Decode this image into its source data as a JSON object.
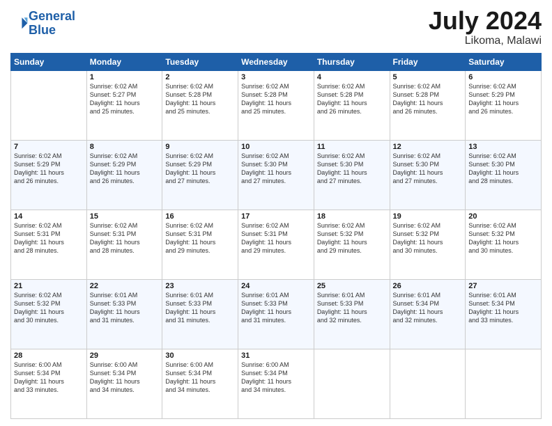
{
  "header": {
    "logo_line1": "General",
    "logo_line2": "Blue",
    "month_year": "July 2024",
    "location": "Likoma, Malawi"
  },
  "days_of_week": [
    "Sunday",
    "Monday",
    "Tuesday",
    "Wednesday",
    "Thursday",
    "Friday",
    "Saturday"
  ],
  "weeks": [
    [
      {
        "day": "",
        "info": ""
      },
      {
        "day": "1",
        "info": "Sunrise: 6:02 AM\nSunset: 5:27 PM\nDaylight: 11 hours\nand 25 minutes."
      },
      {
        "day": "2",
        "info": "Sunrise: 6:02 AM\nSunset: 5:28 PM\nDaylight: 11 hours\nand 25 minutes."
      },
      {
        "day": "3",
        "info": "Sunrise: 6:02 AM\nSunset: 5:28 PM\nDaylight: 11 hours\nand 25 minutes."
      },
      {
        "day": "4",
        "info": "Sunrise: 6:02 AM\nSunset: 5:28 PM\nDaylight: 11 hours\nand 26 minutes."
      },
      {
        "day": "5",
        "info": "Sunrise: 6:02 AM\nSunset: 5:28 PM\nDaylight: 11 hours\nand 26 minutes."
      },
      {
        "day": "6",
        "info": "Sunrise: 6:02 AM\nSunset: 5:29 PM\nDaylight: 11 hours\nand 26 minutes."
      }
    ],
    [
      {
        "day": "7",
        "info": "Sunrise: 6:02 AM\nSunset: 5:29 PM\nDaylight: 11 hours\nand 26 minutes."
      },
      {
        "day": "8",
        "info": "Sunrise: 6:02 AM\nSunset: 5:29 PM\nDaylight: 11 hours\nand 26 minutes."
      },
      {
        "day": "9",
        "info": "Sunrise: 6:02 AM\nSunset: 5:29 PM\nDaylight: 11 hours\nand 27 minutes."
      },
      {
        "day": "10",
        "info": "Sunrise: 6:02 AM\nSunset: 5:30 PM\nDaylight: 11 hours\nand 27 minutes."
      },
      {
        "day": "11",
        "info": "Sunrise: 6:02 AM\nSunset: 5:30 PM\nDaylight: 11 hours\nand 27 minutes."
      },
      {
        "day": "12",
        "info": "Sunrise: 6:02 AM\nSunset: 5:30 PM\nDaylight: 11 hours\nand 27 minutes."
      },
      {
        "day": "13",
        "info": "Sunrise: 6:02 AM\nSunset: 5:30 PM\nDaylight: 11 hours\nand 28 minutes."
      }
    ],
    [
      {
        "day": "14",
        "info": "Sunrise: 6:02 AM\nSunset: 5:31 PM\nDaylight: 11 hours\nand 28 minutes."
      },
      {
        "day": "15",
        "info": "Sunrise: 6:02 AM\nSunset: 5:31 PM\nDaylight: 11 hours\nand 28 minutes."
      },
      {
        "day": "16",
        "info": "Sunrise: 6:02 AM\nSunset: 5:31 PM\nDaylight: 11 hours\nand 29 minutes."
      },
      {
        "day": "17",
        "info": "Sunrise: 6:02 AM\nSunset: 5:31 PM\nDaylight: 11 hours\nand 29 minutes."
      },
      {
        "day": "18",
        "info": "Sunrise: 6:02 AM\nSunset: 5:32 PM\nDaylight: 11 hours\nand 29 minutes."
      },
      {
        "day": "19",
        "info": "Sunrise: 6:02 AM\nSunset: 5:32 PM\nDaylight: 11 hours\nand 30 minutes."
      },
      {
        "day": "20",
        "info": "Sunrise: 6:02 AM\nSunset: 5:32 PM\nDaylight: 11 hours\nand 30 minutes."
      }
    ],
    [
      {
        "day": "21",
        "info": "Sunrise: 6:02 AM\nSunset: 5:32 PM\nDaylight: 11 hours\nand 30 minutes."
      },
      {
        "day": "22",
        "info": "Sunrise: 6:01 AM\nSunset: 5:33 PM\nDaylight: 11 hours\nand 31 minutes."
      },
      {
        "day": "23",
        "info": "Sunrise: 6:01 AM\nSunset: 5:33 PM\nDaylight: 11 hours\nand 31 minutes."
      },
      {
        "day": "24",
        "info": "Sunrise: 6:01 AM\nSunset: 5:33 PM\nDaylight: 11 hours\nand 31 minutes."
      },
      {
        "day": "25",
        "info": "Sunrise: 6:01 AM\nSunset: 5:33 PM\nDaylight: 11 hours\nand 32 minutes."
      },
      {
        "day": "26",
        "info": "Sunrise: 6:01 AM\nSunset: 5:34 PM\nDaylight: 11 hours\nand 32 minutes."
      },
      {
        "day": "27",
        "info": "Sunrise: 6:01 AM\nSunset: 5:34 PM\nDaylight: 11 hours\nand 33 minutes."
      }
    ],
    [
      {
        "day": "28",
        "info": "Sunrise: 6:00 AM\nSunset: 5:34 PM\nDaylight: 11 hours\nand 33 minutes."
      },
      {
        "day": "29",
        "info": "Sunrise: 6:00 AM\nSunset: 5:34 PM\nDaylight: 11 hours\nand 34 minutes."
      },
      {
        "day": "30",
        "info": "Sunrise: 6:00 AM\nSunset: 5:34 PM\nDaylight: 11 hours\nand 34 minutes."
      },
      {
        "day": "31",
        "info": "Sunrise: 6:00 AM\nSunset: 5:34 PM\nDaylight: 11 hours\nand 34 minutes."
      },
      {
        "day": "",
        "info": ""
      },
      {
        "day": "",
        "info": ""
      },
      {
        "day": "",
        "info": ""
      }
    ]
  ]
}
